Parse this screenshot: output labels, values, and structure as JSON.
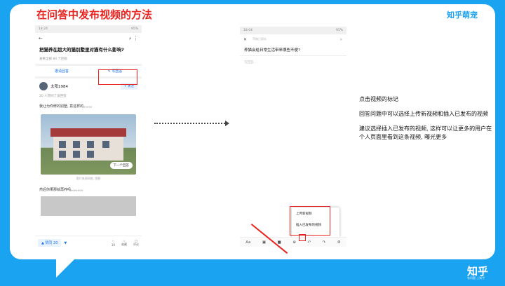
{
  "slide": {
    "title": "在问答中发布视频的方法",
    "brand_logo": "知乎",
    "brand_badge": "知乎萌宠",
    "corner_logo": "知乎",
    "corner_sub": "有问题 上知乎"
  },
  "phone1": {
    "status_time": "18:24",
    "status_right": "95%",
    "question": "把猫养在超大的猫别墅里对猫有什么影响?",
    "meta": "查看全部 84 个回答",
    "invite_label": "邀请回答",
    "write_label": "写回答",
    "author_name": "太阳1984",
    "follow_label": "+ 关注",
    "agree_meta": "20 人赞同了该回答",
    "body_text_1": "我让为你修的别墅, 意这样的。。。。。",
    "next_label": "下一个回答",
    "image_caption": "图片来源网络, 侵删",
    "body_text_2": "然后你果那就再养吗。。。。。。。",
    "agree_label": "▲ 赞同 20",
    "icons": [
      {
        "label": "10"
      },
      {
        "label": "收藏"
      },
      {
        "label": "评论"
      }
    ]
  },
  "phone2": {
    "status_time": "18:04",
    "status_right": "95%",
    "nav_hint": "草稿已保存",
    "question": "养猫会给日常生活带来哪些不便?",
    "placeholder": "写回答...",
    "popup_upload": "上传新视频",
    "popup_insert": "插入已发布的视频",
    "toolbar_text": "Aa"
  },
  "notes": {
    "line1": "点击视频的标记",
    "line2": "回答问题中可以选择上传新视频和插入已发布的视频",
    "line3": "建议选择插入已发布的视频, 这样可以让更多的用户在个人页面里看到这条视频, 曝光更多"
  }
}
